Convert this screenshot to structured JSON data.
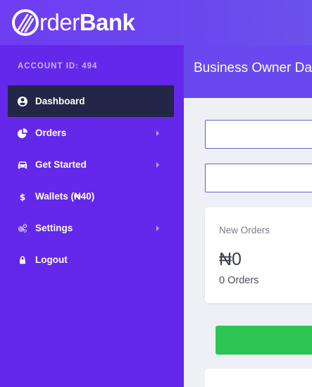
{
  "brand": {
    "prefix": "rder",
    "suffix": "Bank"
  },
  "sidebar": {
    "account_id": "ACCOUNT ID: 494",
    "items": [
      {
        "label": "Dashboard",
        "icon": "user-circle-icon",
        "active": true,
        "has_submenu": false
      },
      {
        "label": "Orders",
        "icon": "pie-chart-icon",
        "active": false,
        "has_submenu": true
      },
      {
        "label": "Get Started",
        "icon": "car-icon",
        "active": false,
        "has_submenu": true
      },
      {
        "label": "Wallets (₦40)",
        "icon": "dollar-icon",
        "active": false,
        "has_submenu": false
      },
      {
        "label": "Settings",
        "icon": "gears-icon",
        "active": false,
        "has_submenu": true
      },
      {
        "label": "Logout",
        "icon": "lock-icon",
        "active": false,
        "has_submenu": false
      }
    ]
  },
  "header": {
    "title": "Business Owner Dashboard"
  },
  "stats_card": {
    "label": "New Orders",
    "amount": "₦0",
    "count": "0 Orders"
  },
  "colors": {
    "sidebar_bg": "#6328ea",
    "active_item_bg": "#242648",
    "header_bg": "#6a48ef",
    "green_button": "#2cc653"
  }
}
